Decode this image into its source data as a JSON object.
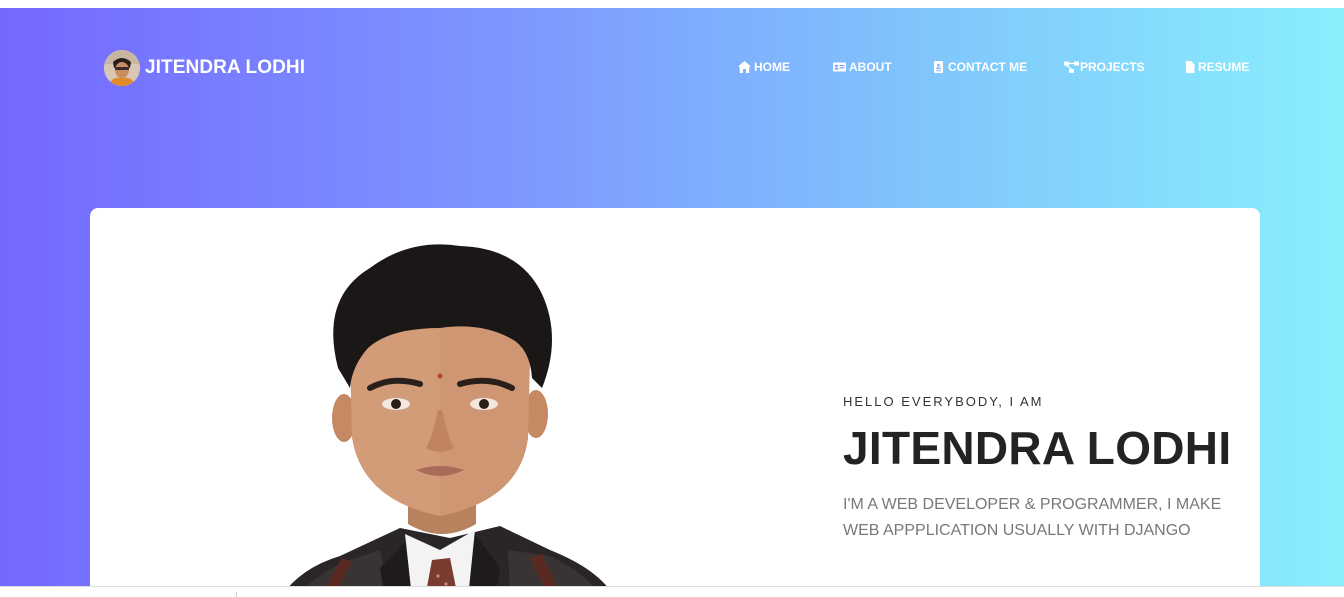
{
  "brand": {
    "name": "JITENDRA LODHI"
  },
  "nav": {
    "items": [
      {
        "label": "HOME",
        "icon": "home-icon"
      },
      {
        "label": "ABOUT",
        "icon": "id-card-icon"
      },
      {
        "label": "CONTACT ME",
        "icon": "contact-card-icon"
      },
      {
        "label": "PROJECTS",
        "icon": "project-diagram-icon"
      },
      {
        "label": "RESUME",
        "icon": "file-icon"
      }
    ]
  },
  "hero": {
    "greeting": "HELLO EVERYBODY, I AM",
    "name": "JITENDRA LODHI",
    "tagline": "I'M A WEB DEVELOPER & PROGRAMMER, I MAKE WEB APPPLICATION USUALLY WITH DJANGO"
  },
  "colors": {
    "gradient_start": "#7468ff",
    "gradient_mid": "#80c7fc",
    "gradient_end": "#8aeffc",
    "card_bg": "#ffffff",
    "name_text": "#232323",
    "tagline_text": "#787878"
  }
}
